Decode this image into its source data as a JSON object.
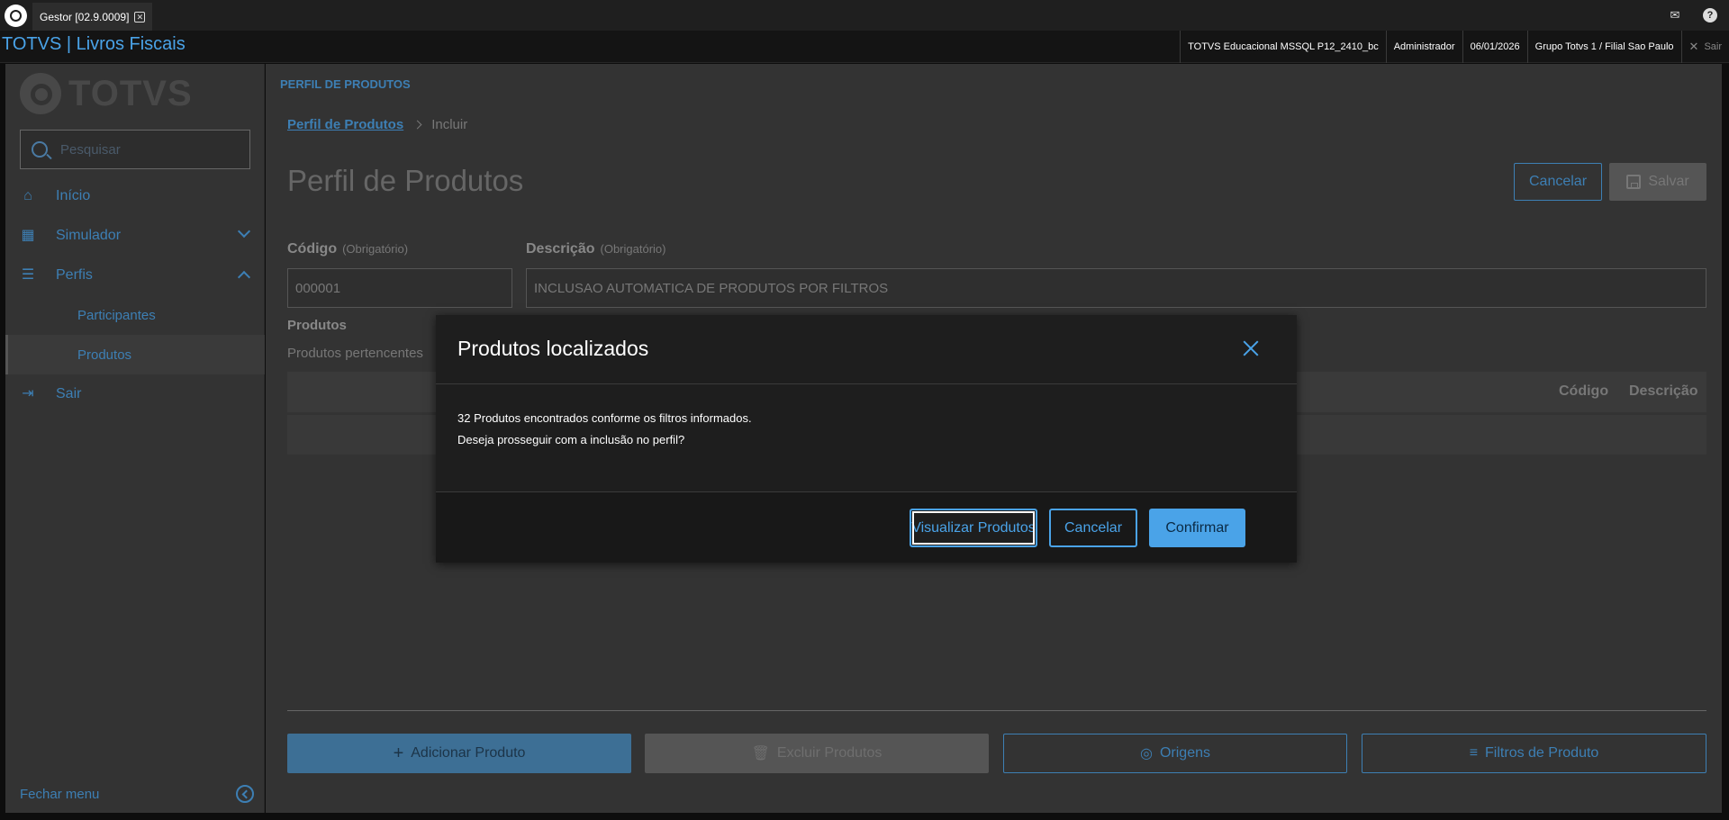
{
  "tabbar": {
    "tab_label": "Gestor [02.9.0009]",
    "tab_close": "✕",
    "mail_icon": "✉",
    "help_icon": "?"
  },
  "header": {
    "brand": "TOTVS | Livros Fiscais",
    "environment": "TOTVS Educacional MSSQL P12_2410_bc",
    "user": "Administrador",
    "date": "06/01/2026",
    "branch": "Grupo Totvs 1 / Filial Sao Paulo",
    "logout": "Sair"
  },
  "sidebar": {
    "logo_text": "TOTVS",
    "search_placeholder": "Pesquisar",
    "items": [
      {
        "label": "Início",
        "icon": "home-icon"
      },
      {
        "label": "Simulador",
        "icon": "calculator-icon"
      },
      {
        "label": "Perfis",
        "icon": "list-icon"
      },
      {
        "label": "Sair",
        "icon": "logout-icon"
      }
    ],
    "subitems": [
      {
        "label": "Participantes"
      },
      {
        "label": "Produtos"
      }
    ],
    "close_menu": "Fechar menu"
  },
  "main": {
    "section_label": "PERFIL DE PRODUTOS",
    "breadcrumb": {
      "link": "Perfil de Produtos",
      "current": "Incluir"
    },
    "title": "Perfil de Produtos",
    "cancel_label": "Cancelar",
    "save_label": "Salvar",
    "code_label": "Código",
    "description_label": "Descrição",
    "required_hint": "(Obrigatório)",
    "code_value": "000001",
    "description_value": "INCLUSAO AUTOMATICA DE PRODUTOS POR FILTROS",
    "products_title": "Produtos",
    "products_subtitle": "Produtos pertencentes",
    "table_columns": [
      "Código",
      "Descrição"
    ],
    "buttons": {
      "add": "Adicionar Produto",
      "delete": "Excluir Produtos",
      "origins": "Origens",
      "filters": "Filtros de Produto"
    }
  },
  "modal": {
    "title": "Produtos localizados",
    "line1": "32 Produtos encontrados conforme os filtros informados.",
    "line2": "Deseja prosseguir com a inclusão no perfil?",
    "view_button": "Visualizar Produtos",
    "cancel_button": "Cancelar",
    "confirm_button": "Confirmar"
  },
  "colors": {
    "accent": "#4aa3e8",
    "muted_accent": "#3d7fb4",
    "background": "#333333"
  }
}
